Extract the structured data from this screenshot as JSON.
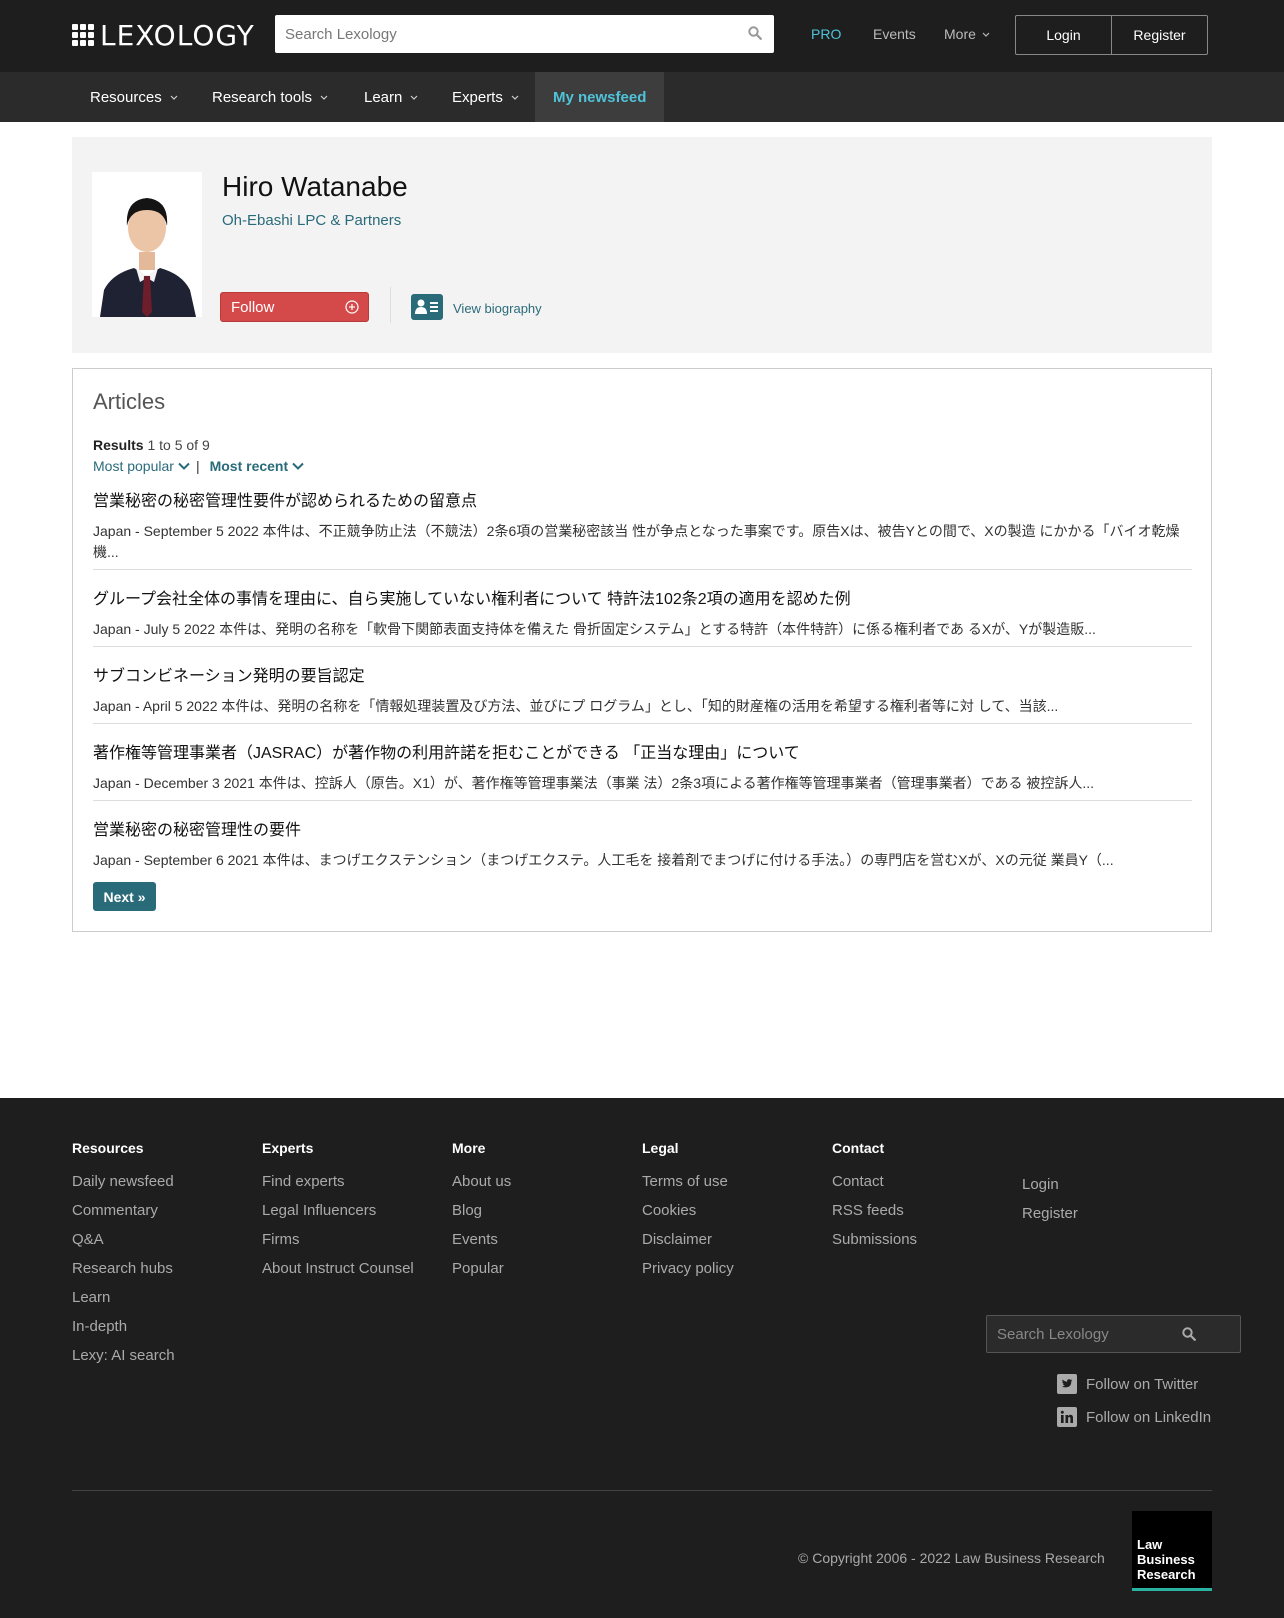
{
  "header": {
    "logo_text": "LEXOLOGY",
    "search_placeholder": "Search Lexology",
    "links": {
      "pro": "PRO",
      "events": "Events",
      "more": "More"
    },
    "login": "Login",
    "register": "Register"
  },
  "nav": {
    "items": [
      "Resources",
      "Research tools",
      "Learn",
      "Experts"
    ],
    "active": "My newsfeed"
  },
  "profile": {
    "name": "Hiro Watanabe",
    "firm": "Oh-Ebashi LPC & Partners",
    "follow": "Follow",
    "view_biography": "View biography"
  },
  "articles": {
    "heading": "Articles",
    "results_label": "Results",
    "results_range": "1 to 5 of 9",
    "sort_popular": "Most popular",
    "sort_recent": "Most recent",
    "sort_separator": "|",
    "items": [
      {
        "title": "営業秘密の秘密管理性要件が認められるための留意点",
        "snippet": "Japan - September 5 2022 本件は、不正競争防止法（不競法）2条6項の営業秘密該当 性が争点となった事案です。原告Xは、被告Yとの間で、Xの製造 にかかる「バイオ乾燥機..."
      },
      {
        "title": "グループ会社全体の事情を理由に、自ら実施していない権利者について 特許法102条2項の適用を認めた例",
        "snippet": "Japan - July 5 2022 本件は、発明の名称を「軟骨下関節表面支持体を備えた 骨折固定システム」とする特許（本件特許）に係る権利者であ るXが、Yが製造販..."
      },
      {
        "title": "サブコンビネーション発明の要旨認定",
        "snippet": "Japan - April 5 2022 本件は、発明の名称を「情報処理装置及び方法、並びにプ ログラム」とし、「知的財産権の活用を希望する権利者等に対 して、当該..."
      },
      {
        "title": "著作権等管理事業者（JASRAC）が著作物の利用許諾を拒むことができる 「正当な理由」について",
        "snippet": "Japan - December 3 2021 本件は、控訴人（原告。X1）が、著作権等管理事業法（事業 法）2条3項による著作権等管理事業者（管理事業者）である 被控訴人..."
      },
      {
        "title": "営業秘密の秘密管理性の要件",
        "snippet": "Japan - September 6 2021 本件は、まつげエクステンション（まつげエクステ。人工毛を 接着剤でまつげに付ける手法。）の専門店を営むXが、Xの元従 業員Y（..."
      }
    ],
    "next": "Next »"
  },
  "footer": {
    "columns": [
      {
        "heading": "Resources",
        "links": [
          "Daily newsfeed",
          "Commentary",
          "Q&A",
          "Research hubs",
          "Learn",
          "In-depth",
          "Lexy: AI search"
        ]
      },
      {
        "heading": "Experts",
        "links": [
          "Find experts",
          "Legal Influencers",
          "Firms",
          "About Instruct Counsel"
        ]
      },
      {
        "heading": "More",
        "links": [
          "About us",
          "Blog",
          "Events",
          "Popular"
        ]
      },
      {
        "heading": "Legal",
        "links": [
          "Terms of use",
          "Cookies",
          "Disclaimer",
          "Privacy policy"
        ]
      },
      {
        "heading": "Contact",
        "links": [
          "Contact",
          "RSS feeds",
          "Submissions"
        ]
      }
    ],
    "account_links": [
      "Login",
      "Register"
    ],
    "search_placeholder": "Search Lexology",
    "twitter": "Follow on Twitter",
    "linkedin": "Follow on LinkedIn",
    "copyright": "© Copyright 2006 - 2022 Law Business Research",
    "lbr_logo": [
      "Law",
      "Business",
      "Research"
    ]
  },
  "colors": {
    "header_bg": "#1e1e1e",
    "accent_teal": "#2a6b7a",
    "pro_cyan": "#4fc3d9",
    "follow_red": "#d44a4a"
  }
}
